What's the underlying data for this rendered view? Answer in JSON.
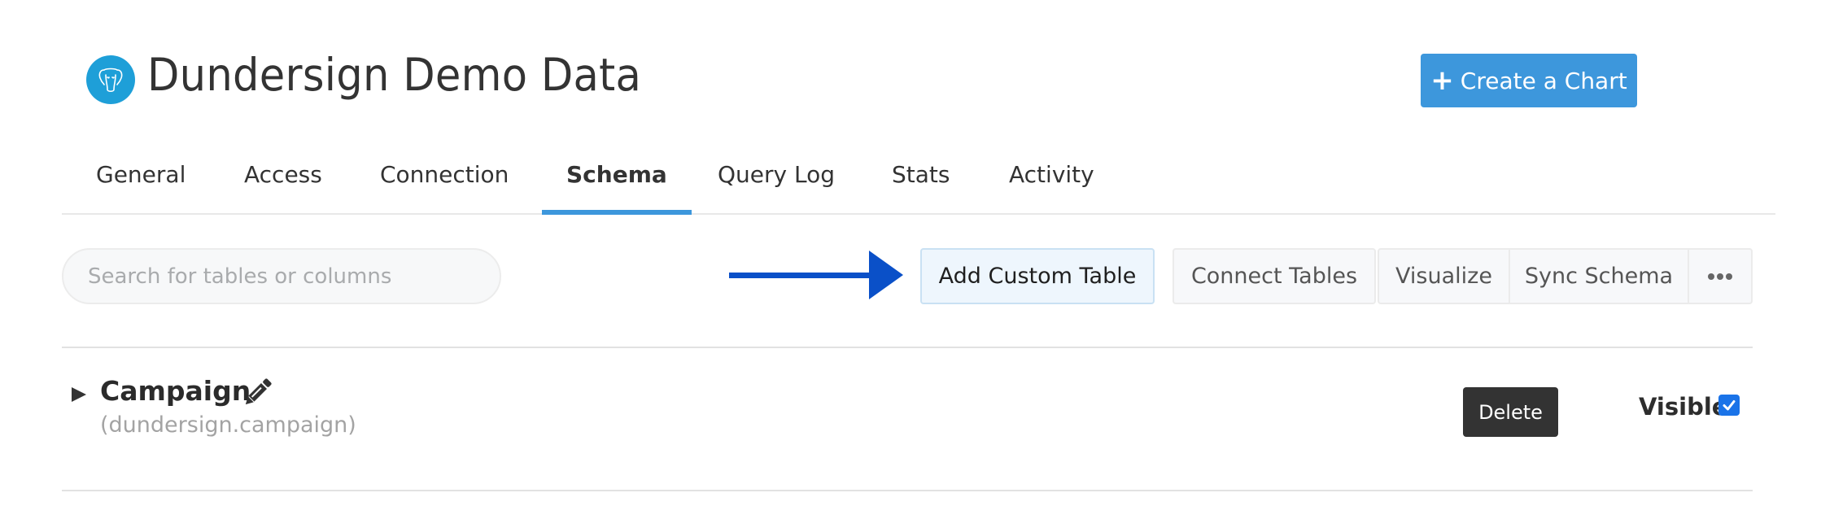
{
  "header": {
    "title": "Dundersign Demo Data",
    "logo_icon": "postgresql-elephant-icon",
    "create_button": {
      "icon": "plus-icon",
      "label": "Create a Chart"
    }
  },
  "tabs": [
    {
      "label": "General",
      "active": false
    },
    {
      "label": "Access",
      "active": false
    },
    {
      "label": "Connection",
      "active": false
    },
    {
      "label": "Schema",
      "active": true
    },
    {
      "label": "Query Log",
      "active": false
    },
    {
      "label": "Stats",
      "active": false
    },
    {
      "label": "Activity",
      "active": false
    }
  ],
  "toolbar": {
    "search_placeholder": "Search for tables or columns",
    "search_value": "",
    "add_custom_table": "Add Custom Table",
    "connect_tables": "Connect Tables",
    "visualize": "Visualize",
    "sync_schema": "Sync Schema",
    "more_icon": "ellipsis-icon"
  },
  "annotation": {
    "arrow_icon": "arrow-right-icon",
    "arrow_color": "#0a50c8"
  },
  "tables": [
    {
      "name": "Campaign",
      "qualified_name": "(dundersign.campaign)",
      "expanded": false,
      "delete_label": "Delete",
      "visible_label": "Visible",
      "visible": true
    }
  ],
  "colors": {
    "accent": "#3d97dc",
    "add_button_bg": "#eef6fd",
    "delete_bg": "#333333",
    "checkbox": "#1a73e8"
  }
}
